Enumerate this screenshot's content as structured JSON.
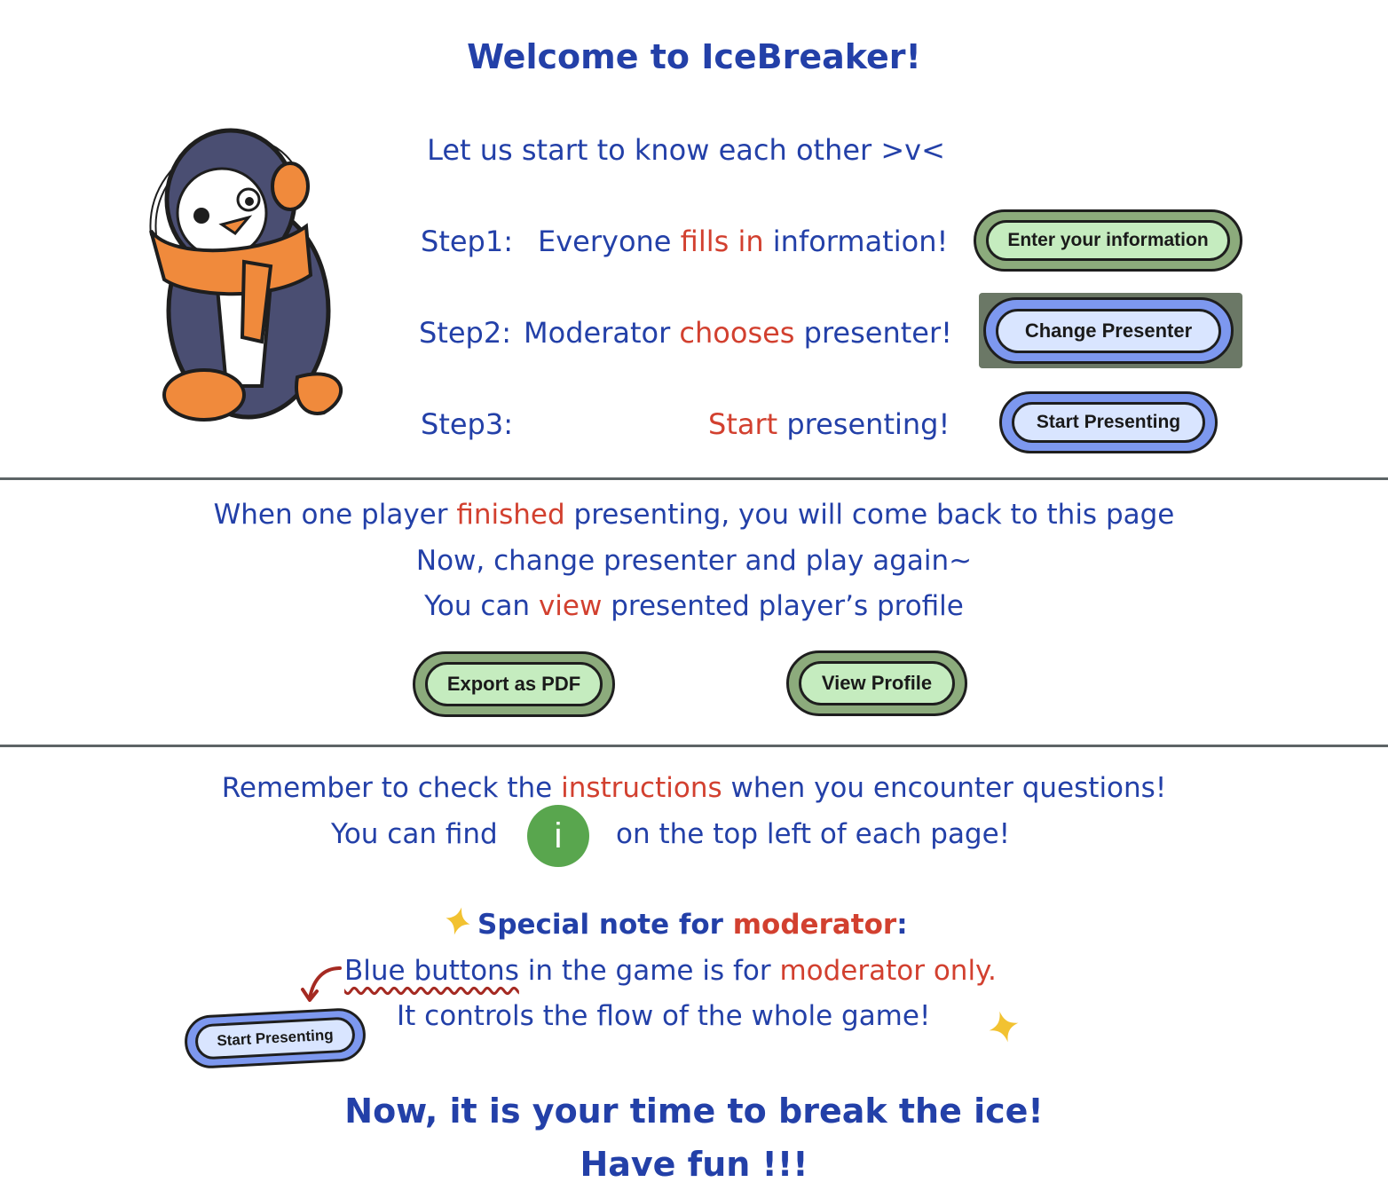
{
  "title": "Welcome to IceBreaker!",
  "intro": "Let us start to know each other >v<",
  "steps": [
    {
      "label": "Step1:",
      "pre": "Everyone ",
      "hl1": "fills",
      "mid": " ",
      "hl2": "in",
      "post": " information!",
      "button": "Enter your information"
    },
    {
      "label": "Step2:",
      "pre": "Moderator ",
      "hl1": "chooses",
      "post": " presenter!",
      "button": "Change Presenter"
    },
    {
      "label": "Step3:",
      "hl1": "Start",
      "post": " presenting!",
      "button": "Start Presenting"
    }
  ],
  "middle": {
    "line1_pre": "When one player ",
    "line1_hl": "finished",
    "line1_post": " presenting, you will come back to this page",
    "line2": "Now, change presenter and play again~",
    "line3_pre": "You can ",
    "line3_hl": "view",
    "line3_post": " presented player’s profile",
    "export_button": "Export as PDF",
    "view_button": "View Profile"
  },
  "bottom": {
    "remember_pre": "Remember to check the ",
    "remember_hl": "instructions",
    "remember_post": " when you encounter questions!",
    "find_pre": "You can find",
    "info_icon": "i",
    "find_post": "on the top left of each page!",
    "note_pre": "Special note for ",
    "note_hl": "moderator",
    "note_post": ":",
    "blue_underlined": "Blue buttons",
    "blue_mid": " in the game is for ",
    "blue_hl": "moderator only.",
    "controls": "It controls the flow of the whole game!",
    "example_button": "Start Presenting",
    "closing1": "Now, it is your time to break the ice!",
    "closing2": "Have fun !!!"
  },
  "colors": {
    "text_blue": "#2340a8",
    "highlight_red": "#d2402f",
    "green_button": "#c5ecbf",
    "blue_button": "#d9e5ff",
    "info_green": "#59a64e",
    "divider": "#5d6466",
    "star_yellow": "#f2c231"
  },
  "icons": {
    "mascot": "penguin-with-earmuffs",
    "info": "info-icon",
    "star": "sparkle-star-icon",
    "arrow": "curved-arrow-icon"
  }
}
